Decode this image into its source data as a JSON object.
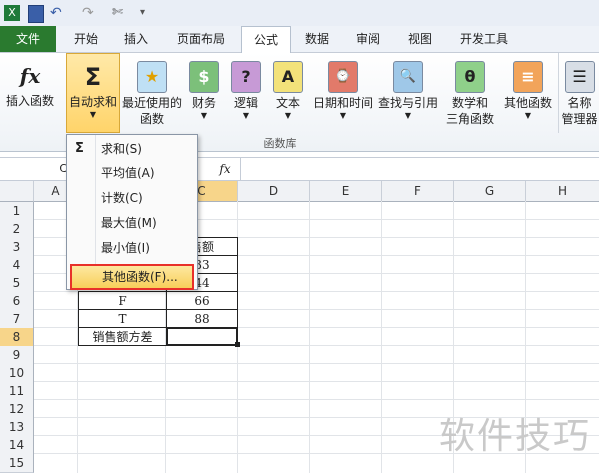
{
  "tabs": [
    "文件",
    "开始",
    "插入",
    "页面布局",
    "公式",
    "数据",
    "审阅",
    "视图",
    "开发工具"
  ],
  "ribbon": {
    "buttons": [
      {
        "label": "插入函数",
        "icon": "fx-icon",
        "glyph": "fx"
      },
      {
        "label": "自动求和",
        "icon": "sigma-icon",
        "glyph": "Σ"
      },
      {
        "label": "最近使用的\n函数",
        "icon": "star-book-icon",
        "glyph": "★"
      },
      {
        "label": "财务",
        "icon": "finance-book-icon",
        "glyph": "$"
      },
      {
        "label": "逻辑",
        "icon": "logic-book-icon",
        "glyph": "?"
      },
      {
        "label": "文本",
        "icon": "text-book-icon",
        "glyph": "A"
      },
      {
        "label": "日期和时间",
        "icon": "date-book-icon",
        "glyph": "⌚"
      },
      {
        "label": "查找与引用",
        "icon": "lookup-book-icon",
        "glyph": "🔍"
      },
      {
        "label": "数学和\n三角函数",
        "icon": "math-book-icon",
        "glyph": "θ"
      },
      {
        "label": "其他函数",
        "icon": "more-book-icon",
        "glyph": "≡"
      },
      {
        "label": "名称\n管理器",
        "icon": "name-manager-icon",
        "glyph": "☰"
      }
    ],
    "group_label": "函数库"
  },
  "formula_bar": {
    "fx": "fx",
    "name_box": "C"
  },
  "columns": [
    "A",
    "B",
    "C",
    "D",
    "E",
    "F",
    "G",
    "H"
  ],
  "rows": [
    "1",
    "2",
    "3",
    "4",
    "5",
    "6",
    "7",
    "8",
    "9",
    "10",
    "11",
    "12",
    "13",
    "14",
    "15"
  ],
  "cells": {
    "c3": "售额",
    "c4": "33",
    "c5": "44",
    "b6": "F",
    "c6": "66",
    "b7": "T",
    "c7": "88",
    "b8": "销售额方差"
  },
  "menu": {
    "items": [
      "求和(S)",
      "平均值(A)",
      "计数(C)",
      "最大值(M)",
      "最小值(I)",
      "其他函数(F)..."
    ],
    "sigma": "Σ"
  },
  "watermark": "软件技巧",
  "colors": {
    "file_tab": "#2a7a2f",
    "highlight": "#ffd46a",
    "menu_outline": "#e8302a"
  }
}
